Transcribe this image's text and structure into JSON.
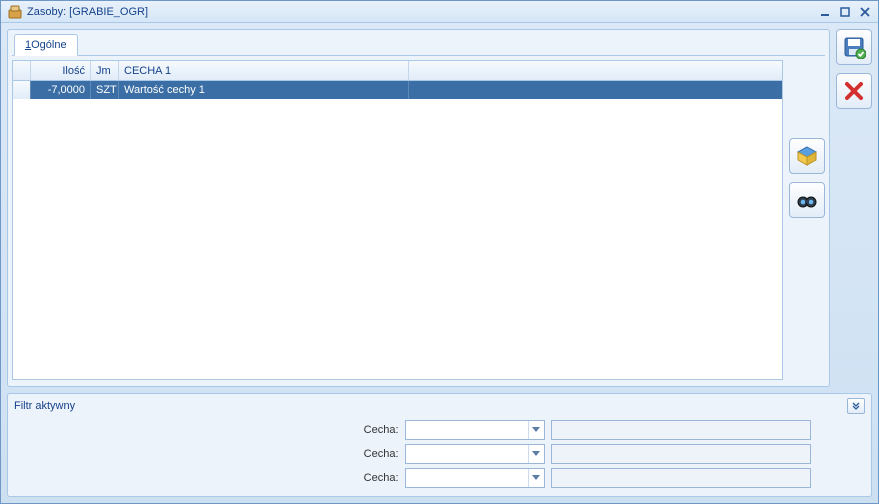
{
  "title": "Zasoby: [GRABIE_OGR]",
  "tab_label_prefix": "1",
  "tab_label_rest": " Ogólne",
  "grid": {
    "headers": {
      "ilosc": "Ilość",
      "jm": "Jm",
      "cecha1": "CECHA 1"
    },
    "row": {
      "ilosc": "-7,0000",
      "jm": "SZT",
      "cecha1": "Wartość cechy 1"
    }
  },
  "filter": {
    "title": "Filtr aktywny",
    "label": "Cecha:"
  },
  "icons": {
    "app": "app-icon",
    "minimize": "minimize-icon",
    "maximize": "maximize-icon",
    "close_win": "close-window-icon",
    "save": "save-icon",
    "close": "close-icon",
    "pack": "package-icon",
    "find": "binoculars-icon",
    "chevron": "chevron-down-double-icon"
  }
}
